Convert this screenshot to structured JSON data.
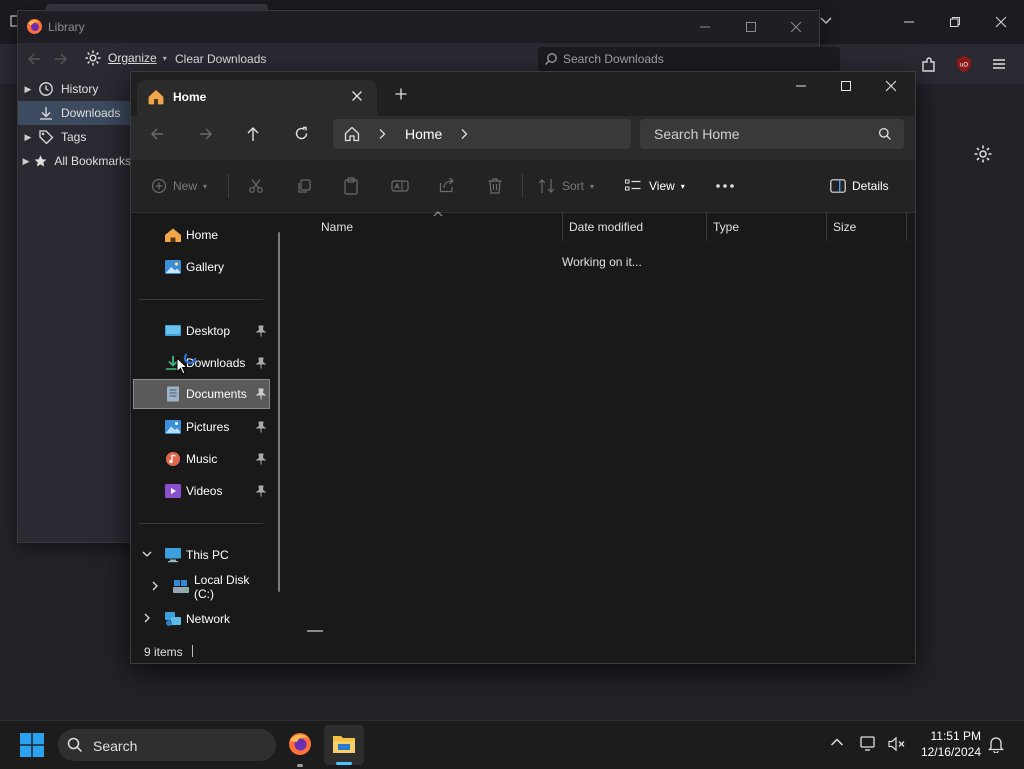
{
  "library": {
    "title": "Library",
    "toolbar": {
      "organize": "Organize",
      "clear_downloads": "Clear Downloads"
    },
    "search_placeholder": "Search Downloads",
    "sidebar": [
      {
        "label": "History",
        "icon": "clock-icon"
      },
      {
        "label": "Downloads",
        "icon": "download-icon",
        "selected": true
      },
      {
        "label": "Tags",
        "icon": "tag-icon"
      },
      {
        "label": "All Bookmarks",
        "icon": "star-icon"
      }
    ]
  },
  "explorer": {
    "tab_label": "Home",
    "address": {
      "crumb": "Home"
    },
    "search_placeholder": "Search Home",
    "commands": {
      "new": "New",
      "sort": "Sort",
      "view": "View",
      "details": "Details"
    },
    "nav": {
      "home": "Home",
      "gallery": "Gallery",
      "desktop": "Desktop",
      "downloads": "Downloads",
      "documents": "Documents",
      "pictures": "Pictures",
      "music": "Music",
      "videos": "Videos",
      "this_pc": "This PC",
      "local_disk": "Local Disk (C:)",
      "network": "Network"
    },
    "columns": {
      "name": "Name",
      "date_modified": "Date modified",
      "type": "Type",
      "size": "Size"
    },
    "loading_text": "Working on it...",
    "status": "9 items"
  },
  "taskbar": {
    "search_label": "Search",
    "time": "11:51 PM",
    "date": "12/16/2024"
  },
  "colors": {
    "accent": "#0078d4",
    "selection": "#5a5a5a",
    "firefox": "#ff7139",
    "folder": "#f5c242"
  }
}
